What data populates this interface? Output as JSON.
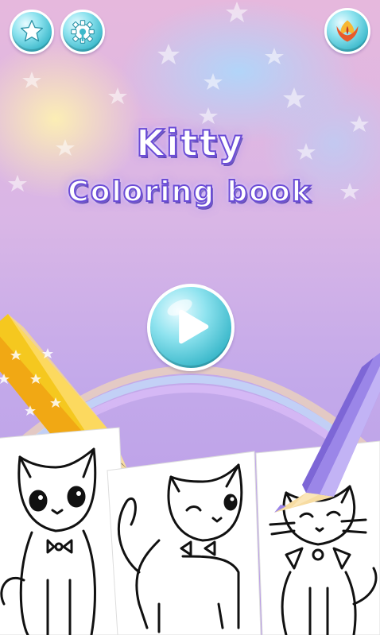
{
  "title": {
    "line1": "Kitty",
    "line2": "Coloring book"
  },
  "buttons": {
    "favorites_icon": "star-icon",
    "settings_icon": "gear-icon",
    "more_apps_icon": "phoenix-logo-icon",
    "play_icon": "play-icon"
  },
  "colors": {
    "button_teal": "#3cb9cb",
    "title_stroke": "#6a4bd6",
    "pencil_yellow": "#f4c21a",
    "pencil_purple": "#9b86e8"
  }
}
